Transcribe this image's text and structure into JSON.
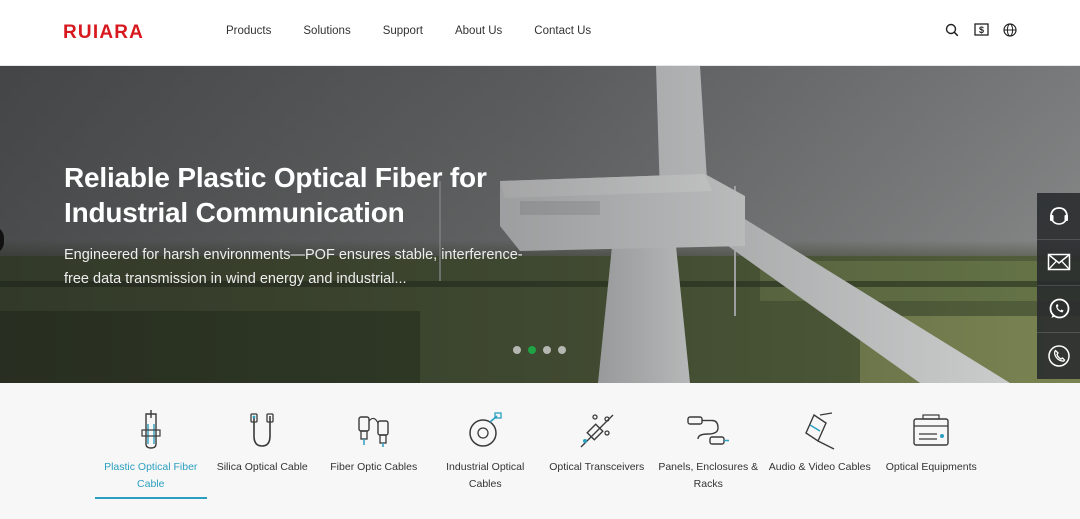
{
  "brand": {
    "logo_text": "RUIARA",
    "logo_color": "#d7191f"
  },
  "nav": {
    "items": [
      "Products",
      "Solutions",
      "Support",
      "About Us",
      "Contact Us"
    ]
  },
  "header_icons": [
    "search-icon",
    "price-tag-icon",
    "globe-icon"
  ],
  "hero": {
    "title": "Reliable Plastic Optical Fiber for Industrial Communication",
    "subtitle": "Engineered for harsh environments—POF ensures stable, interference-free data transmission in wind energy and industrial...",
    "slide_count": 4,
    "active_slide": 2,
    "active_dot_color": "#1fa345"
  },
  "float_bar": [
    "customer-service-icon",
    "email-icon",
    "whatsapp-icon",
    "phone-icon"
  ],
  "categories": {
    "active_color": "#2c9fc0",
    "items": [
      {
        "label": "Plastic Optical Fiber Cable",
        "icon": "pof-cable-icon",
        "active": true
      },
      {
        "label": "Silica Optical Cable",
        "icon": "silica-cable-icon",
        "active": false
      },
      {
        "label": "Fiber Optic Cables",
        "icon": "fiber-connector-icon",
        "active": false
      },
      {
        "label": "Industrial Optical Cables",
        "icon": "cable-reel-icon",
        "active": false
      },
      {
        "label": "Optical Transceivers",
        "icon": "transceiver-icon",
        "active": false
      },
      {
        "label": "Panels, Enclosures & Racks",
        "icon": "panel-icon",
        "active": false
      },
      {
        "label": "Audio & Video Cables",
        "icon": "av-cable-icon",
        "active": false
      },
      {
        "label": "Optical Equipments",
        "icon": "equipment-icon",
        "active": false
      }
    ]
  }
}
